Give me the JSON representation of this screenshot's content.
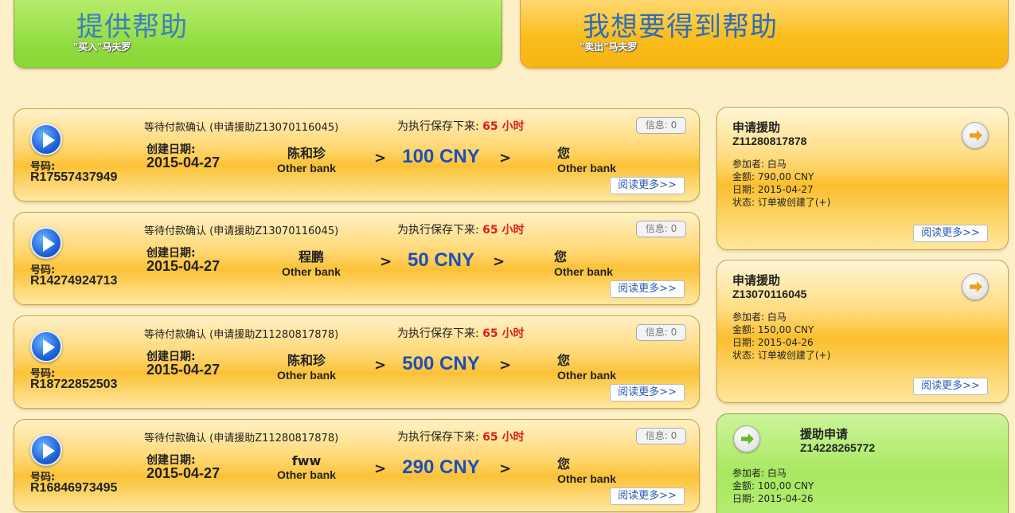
{
  "header": {
    "give": {
      "title": "提供帮助",
      "subtitle": "\"买入\"马夫罗"
    },
    "get": {
      "title": "我想要得到帮助",
      "subtitle": "\"卖出\"马夫罗"
    }
  },
  "labels": {
    "number": "号码:",
    "created": "创建日期:",
    "keep_prefix": "为执行保存下来: ",
    "keep_hours": "65 小时",
    "info": "信息: 0",
    "arrow": ">",
    "you": "您",
    "bank": "Other bank",
    "read_more": "阅读更多>>"
  },
  "orders": [
    {
      "number": "R17557437949",
      "status": "等待付款确认 (申请援助Z13070116045)",
      "date": "2015-04-27",
      "sender": "陈和珍",
      "amount": "100 CNY"
    },
    {
      "number": "R14274924713",
      "status": "等待付款确认 (申请援助Z13070116045)",
      "date": "2015-04-27",
      "sender": "程鹏",
      "amount": "50 CNY"
    },
    {
      "number": "R18722852503",
      "status": "等待付款确认 (申请援助Z11280817878)",
      "date": "2015-04-27",
      "sender": "陈和珍",
      "amount": "500 CNY"
    },
    {
      "number": "R16846973495",
      "status": "等待付款确认 (申请援助Z11280817878)",
      "date": "2015-04-27",
      "sender": "fww",
      "amount": "290 CNY"
    }
  ],
  "requests": [
    {
      "title": "申请援助",
      "id": "Z11280817878",
      "participant": "参加者: 白马",
      "amount": "金额: 790,00 CNY",
      "date": "日期: 2015-04-27",
      "status": "状态: 订单被创建了(+)",
      "read_more": "阅读更多>>"
    },
    {
      "title": "申请援助",
      "id": "Z13070116045",
      "participant": "参加者: 白马",
      "amount": "金额: 150,00 CNY",
      "date": "日期: 2015-04-26",
      "status": "状态: 订单被创建了(+)",
      "read_more": "阅读更多>>"
    },
    {
      "title": "援助申请",
      "id": "Z14228265772",
      "participant": "参加者: 白马",
      "amount": "金额: 100,00 CNY",
      "date": "日期: 2015-04-26"
    }
  ]
}
